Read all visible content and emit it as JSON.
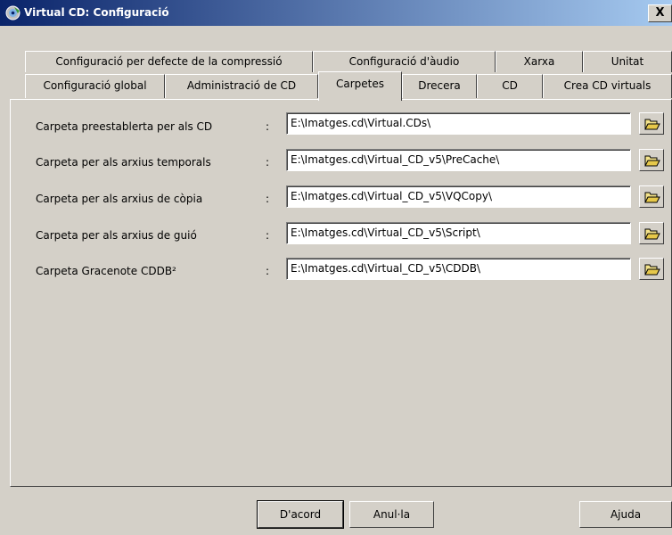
{
  "window": {
    "title": "Virtual CD: Configuració",
    "close_label": "X"
  },
  "tabs_row1": [
    {
      "label": "Configuració per defecte de la compressió"
    },
    {
      "label": "Configuració d'àudio"
    },
    {
      "label": "Xarxa"
    },
    {
      "label": "Unitat"
    }
  ],
  "tabs_row2": [
    {
      "label": "Configuració global"
    },
    {
      "label": "Administració de CD"
    },
    {
      "label": "Carpetes",
      "active": true
    },
    {
      "label": "Drecera"
    },
    {
      "label": "CD"
    },
    {
      "label": "Crea CD virtuals"
    }
  ],
  "folders": [
    {
      "label": "Carpeta preestablerta per als CD",
      "colon": ":",
      "value": "E:\\Imatges.cd\\Virtual.CDs\\"
    },
    {
      "label": "Carpeta per als arxius temporals",
      "colon": ":",
      "value": "E:\\Imatges.cd\\Virtual_CD_v5\\PreCache\\"
    },
    {
      "label": "Carpeta per als arxius de còpia",
      "colon": ":",
      "value": "E:\\Imatges.cd\\Virtual_CD_v5\\VQCopy\\"
    },
    {
      "label": "Carpeta per als arxius de guió",
      "colon": ":",
      "value": "E:\\Imatges.cd\\Virtual_CD_v5\\Script\\"
    },
    {
      "label": "Carpeta Gracenote CDDB²",
      "colon": ":",
      "value": "E:\\Imatges.cd\\Virtual_CD_v5\\CDDB\\"
    }
  ],
  "buttons": {
    "ok": "D'acord",
    "cancel": "Anul·la",
    "help": "Ajuda"
  },
  "icons": {
    "app": "virtual-cd-app-icon",
    "browse": "open-folder-icon"
  },
  "colors": {
    "titlebar_start": "#0a246a",
    "titlebar_end": "#a6caf0",
    "face": "#d4d0c8"
  }
}
